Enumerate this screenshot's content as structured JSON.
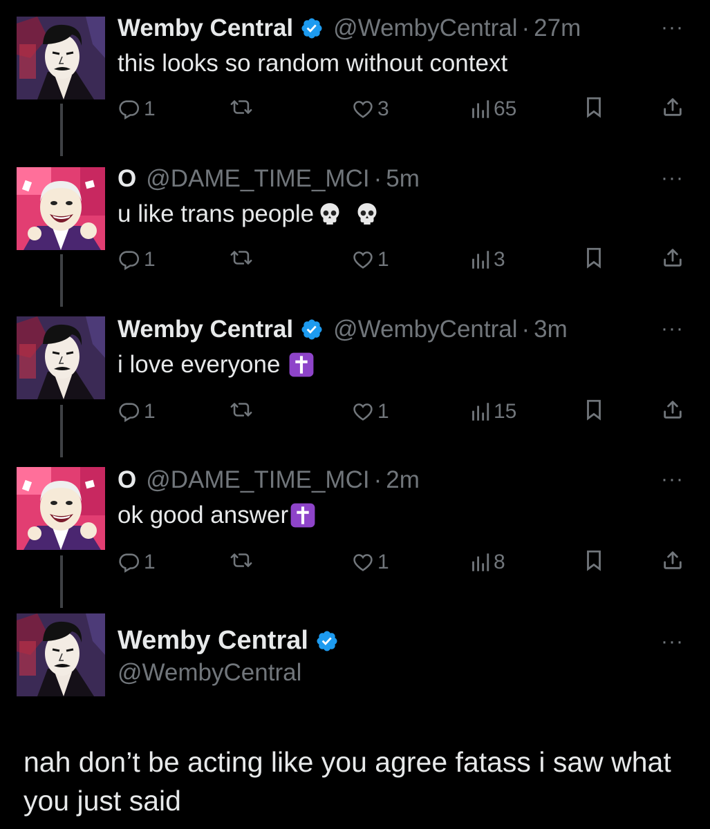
{
  "accent": "#1d9bf0",
  "muted_color": "#71767b",
  "avatar_a": "noir-gangster-portrait",
  "avatar_b": "laughing-bald-cartoon",
  "tweets": [
    {
      "name": "Wemby Central",
      "verified": true,
      "handle": "@WembyCentral",
      "time": "27m",
      "text": "this looks so random without context",
      "emoji": [],
      "replies": "1",
      "reposts": "",
      "likes": "3",
      "views": "65"
    },
    {
      "name": "O",
      "verified": false,
      "handle": "@DAME_TIME_MCI",
      "time": "5m",
      "text": "u like trans people",
      "emoji": [
        "skull",
        "skull"
      ],
      "replies": "1",
      "reposts": "",
      "likes": "1",
      "views": "3"
    },
    {
      "name": "Wemby Central",
      "verified": true,
      "handle": "@WembyCentral",
      "time": "3m",
      "text": "i love everyone",
      "emoji": [
        "latin-cross"
      ],
      "replies": "1",
      "reposts": "",
      "likes": "1",
      "views": "15"
    },
    {
      "name": "O",
      "verified": false,
      "handle": "@DAME_TIME_MCI",
      "time": "2m",
      "text": "ok good answer",
      "emoji": [
        "latin-cross"
      ],
      "replies": "1",
      "reposts": "",
      "likes": "1",
      "views": "8"
    }
  ],
  "focal": {
    "name": "Wemby Central",
    "verified": true,
    "handle": "@WembyCentral",
    "text": "nah don’t be acting like you agree fatass i saw what you just said"
  },
  "separator": "·",
  "more_label": "···"
}
